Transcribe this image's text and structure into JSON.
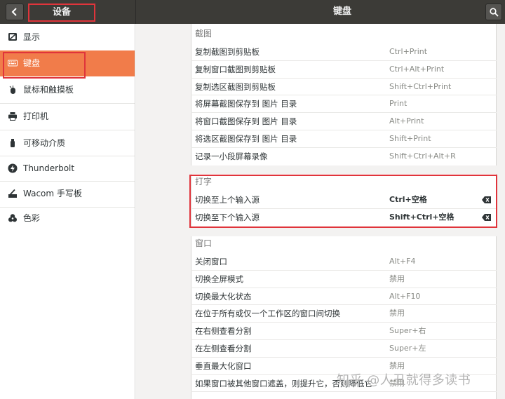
{
  "header": {
    "left_title": "设备",
    "title": "键盘"
  },
  "sidebar": {
    "items": [
      {
        "label": "显示",
        "icon": "display-icon"
      },
      {
        "label": "键盘",
        "icon": "keyboard-icon",
        "active": true
      },
      {
        "label": "鼠标和触摸板",
        "icon": "mouse-icon"
      },
      {
        "label": "打印机",
        "icon": "printer-icon"
      },
      {
        "label": "可移动介质",
        "icon": "usb-icon"
      },
      {
        "label": "Thunderbolt",
        "icon": "thunderbolt-icon"
      },
      {
        "label": "Wacom 手写板",
        "icon": "tablet-icon"
      },
      {
        "label": "色彩",
        "icon": "color-icon"
      }
    ]
  },
  "sections": {
    "screenshot": {
      "title": "截图",
      "rows": [
        {
          "name": "复制截图到剪贴板",
          "accel": "Ctrl+Print"
        },
        {
          "name": "复制窗口截图到剪贴板",
          "accel": "Ctrl+Alt+Print"
        },
        {
          "name": "复制选区截图到剪贴板",
          "accel": "Shift+Ctrl+Print"
        },
        {
          "name": "将屏幕截图保存到 图片 目录",
          "accel": "Print"
        },
        {
          "name": "将窗口截图保存到 图片 目录",
          "accel": "Alt+Print"
        },
        {
          "name": "将选区截图保存到 图片 目录",
          "accel": "Shift+Print"
        },
        {
          "name": "记录一小段屏幕录像",
          "accel": "Shift+Ctrl+Alt+R"
        }
      ]
    },
    "typing": {
      "title": "打字",
      "rows": [
        {
          "name": "切换至上个输入源",
          "accel": "Ctrl+空格"
        },
        {
          "name": "切换至下个输入源",
          "accel": "Shift+Ctrl+空格"
        }
      ]
    },
    "windows": {
      "title": "窗口",
      "rows": [
        {
          "name": "关闭窗口",
          "accel": "Alt+F4"
        },
        {
          "name": "切换全屏模式",
          "accel": "禁用"
        },
        {
          "name": "切换最大化状态",
          "accel": "Alt+F10"
        },
        {
          "name": "在位于所有或仅一个工作区的窗口间切换",
          "accel": "禁用"
        },
        {
          "name": "在右侧查看分割",
          "accel": "Super+右"
        },
        {
          "name": "在左侧查看分割",
          "accel": "Super+左"
        },
        {
          "name": "垂直最大化窗口",
          "accel": "禁用"
        },
        {
          "name": "如果窗口被其他窗口遮盖，则提升它，否则降低它",
          "accel": "禁用"
        }
      ]
    }
  },
  "watermark": "知乎 @人丑就得多读书"
}
